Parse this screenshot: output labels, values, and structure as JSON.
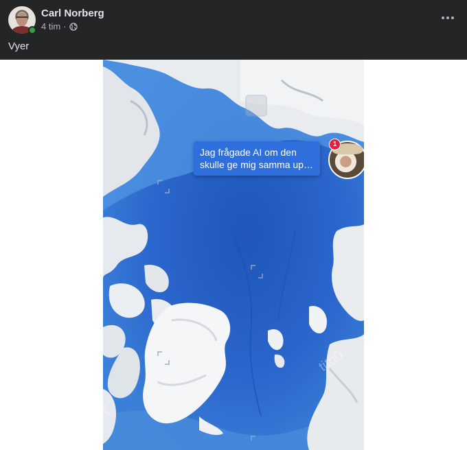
{
  "post": {
    "author": "Carl Norberg",
    "time": "4 tim",
    "separator": "·",
    "privacy_icon": "globe-icon",
    "text": "Vyer"
  },
  "media": {
    "chat_bubble": {
      "line1": "Jag frågade AI om den",
      "line2": "skulle ge mig samma up…"
    },
    "chat_head_badge": "1",
    "watermark": "tito0"
  },
  "colors": {
    "header_bg": "#242526",
    "ocean": "#2a64c5",
    "bubble": "#2e6fdc",
    "badge": "#e41e3f",
    "online": "#31a24c"
  }
}
